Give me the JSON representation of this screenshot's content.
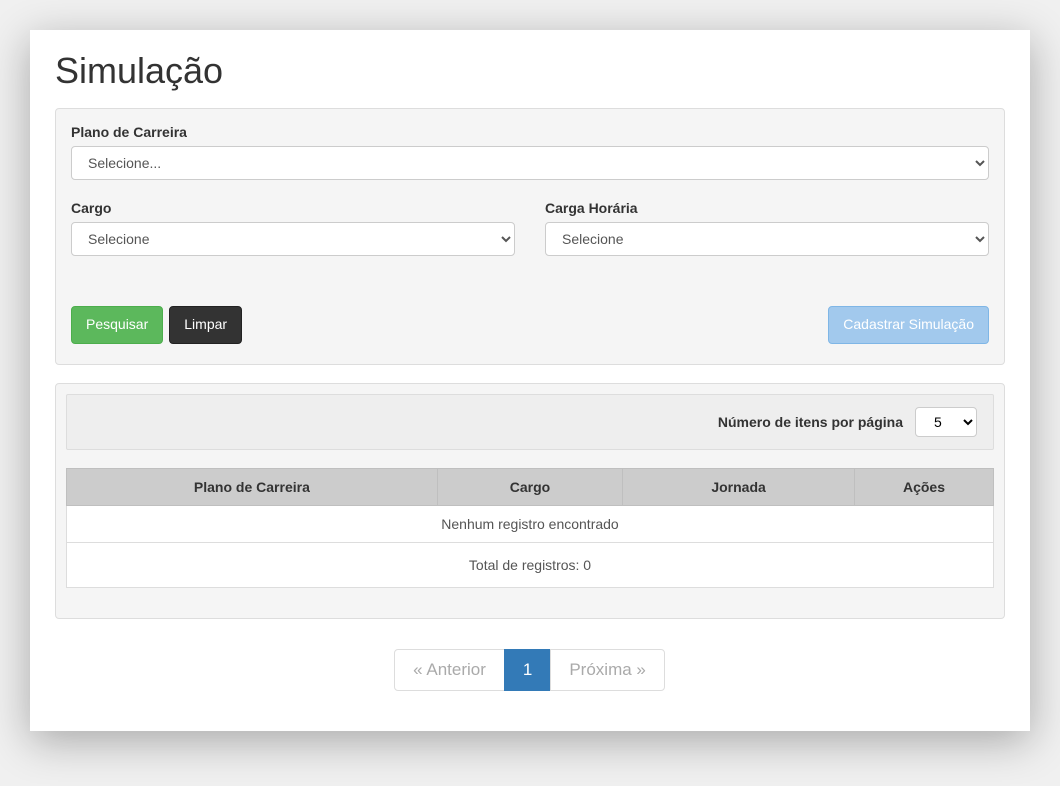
{
  "title": "Simulação",
  "form": {
    "plano_label": "Plano de Carreira",
    "plano_placeholder": "Selecione...",
    "cargo_label": "Cargo",
    "cargo_placeholder": "Selecione",
    "carga_label": "Carga Horária",
    "carga_placeholder": "Selecione",
    "pesquisar": "Pesquisar",
    "limpar": "Limpar",
    "cadastrar": "Cadastrar Simulação"
  },
  "results": {
    "items_per_page_label": "Número de itens por página",
    "items_per_page_value": "5",
    "columns": {
      "plano": "Plano de Carreira",
      "cargo": "Cargo",
      "jornada": "Jornada",
      "acoes": "Ações"
    },
    "empty_message": "Nenhum registro encontrado",
    "total_label": "Total de registros: 0"
  },
  "pagination": {
    "prev": "« Anterior",
    "current": "1",
    "next": "Próxima »"
  }
}
